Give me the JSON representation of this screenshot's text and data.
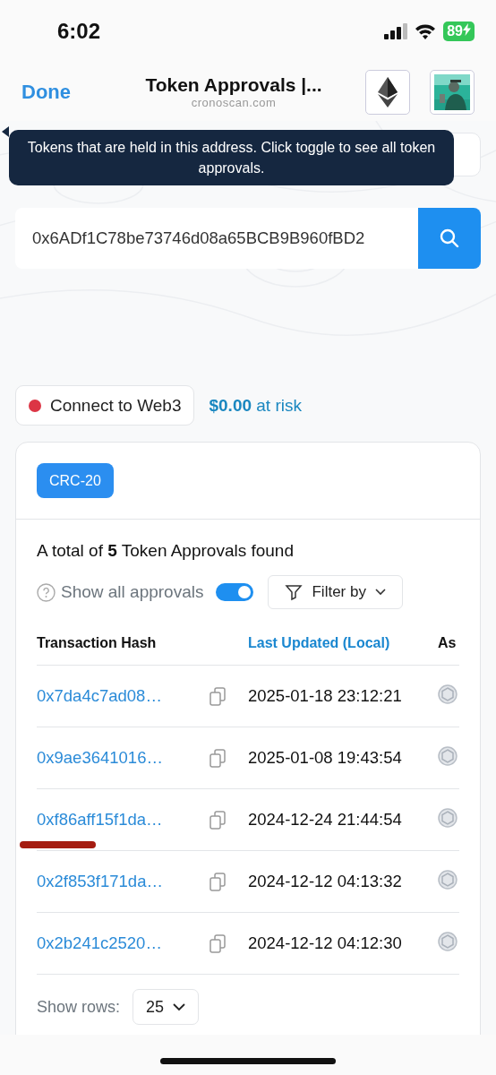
{
  "status_bar": {
    "time": "6:02",
    "battery": "89"
  },
  "browser": {
    "done": "Done",
    "title": "Token Approvals |...",
    "domain": "cronoscan.com"
  },
  "tooltip": {
    "text": "Tokens that are held in this address. Click toggle to see all token approvals."
  },
  "address_search": {
    "value": "0x6ADf1C78be73746d08a65BCB9B960fBD2"
  },
  "connect": {
    "label": "Connect to Web3",
    "connected": false
  },
  "risk": "**$0.00** at risk",
  "tabs": [
    {
      "label": "CRC-20",
      "selected": true
    }
  ],
  "summary": "A total of **5** Token Approvals found",
  "show_all": {
    "label": "Show all approvals",
    "on": true
  },
  "filter": {
    "label": "Filter by"
  },
  "table": {
    "columns": [
      {
        "label": "Transaction Hash",
        "sorted": false
      },
      {
        "label": "Last Updated (Local)",
        "sorted": true
      },
      {
        "label": "As",
        "sorted": false
      }
    ],
    "rows": [
      {
        "hash": "0x7da4c7ad08…",
        "updated": "2025-01-18 23:12:21",
        "marked": false
      },
      {
        "hash": "0x9ae3641016…",
        "updated": "2025-01-08 19:43:54",
        "marked": false
      },
      {
        "hash": "0xf86aff15f1da…",
        "updated": "2024-12-24 21:44:54",
        "marked": true
      },
      {
        "hash": "0x2f853f171da…",
        "updated": "2024-12-12 04:13:32",
        "marked": false
      },
      {
        "hash": "0x2b241c2520…",
        "updated": "2024-12-12 04:12:30",
        "marked": false
      }
    ]
  },
  "pagination": {
    "label": "Show rows:",
    "value": "25"
  }
}
